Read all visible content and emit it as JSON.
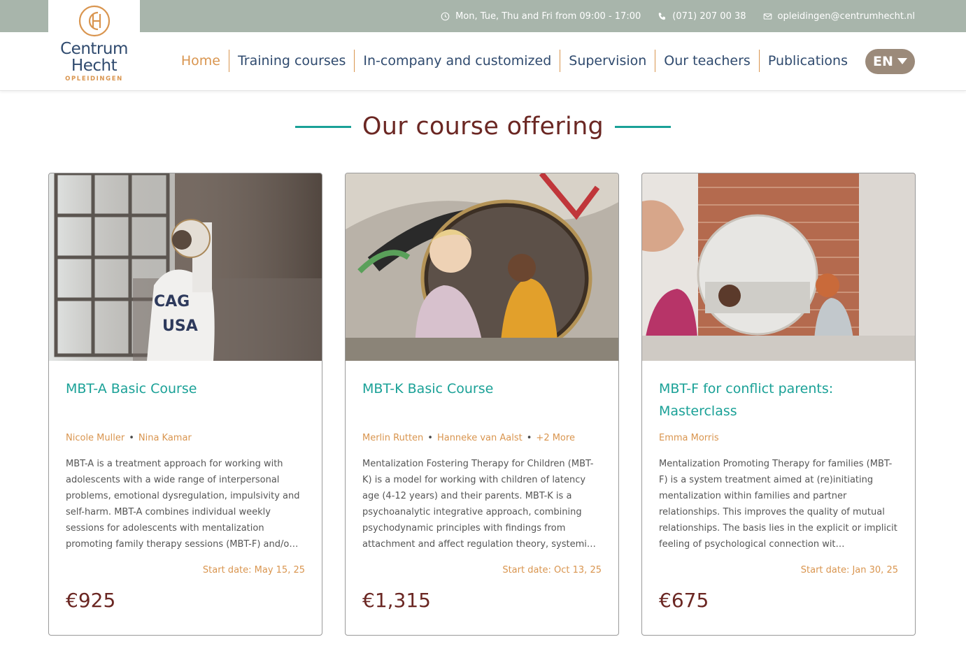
{
  "topbar": {
    "hours": "Mon, Tue, Thu and Fri from 09:00 - 17:00",
    "phone": "(071) 207 00 38",
    "email": "opleidingen@centrumhecht.nl"
  },
  "logo": {
    "line1": "Centrum",
    "line2": "Hecht",
    "sub": "OPLEIDINGEN"
  },
  "nav": {
    "items": [
      {
        "label": "Home"
      },
      {
        "label": "Training courses"
      },
      {
        "label": "In-company and customized"
      },
      {
        "label": "Supervision"
      },
      {
        "label": "Our teachers"
      },
      {
        "label": "Publications"
      }
    ],
    "lang": "EN"
  },
  "section": {
    "title": "Our course offering"
  },
  "courses": [
    {
      "title": "MBT-A Basic Course",
      "teachers": [
        "Nicole Muller",
        "Nina Kamar"
      ],
      "more": "",
      "description": "MBT-A is a treatment approach for working with adolescents with a wide range of interpersonal problems, emotional dysregulation, impulsivity and self-harm. MBT-A combines individual weekly sessions for adolescents with mentalization promoting family therapy sessions (MBT-F) and/o…",
      "start": "Start date: May 15, 25",
      "price": "€925"
    },
    {
      "title": "MBT-K Basic Course",
      "teachers": [
        "Merlin Rutten",
        "Hanneke van Aalst"
      ],
      "more": "+2 More",
      "description": "Mentalization Fostering Therapy for Children (MBT-K) is a model for working with children of latency age (4-12 years) and their parents. MBT-K is a psychoanalytic integrative approach, combining psychodynamic principles with findings from attachment and affect regulation theory, systemi…",
      "start": "Start date: Oct 13, 25",
      "price": "€1,315"
    },
    {
      "title": "MBT-F for conflict parents: Masterclass",
      "teachers": [
        "Emma Morris"
      ],
      "more": "",
      "description": "Mentalization Promoting Therapy for families (MBT-F) is a system treatment aimed at (re)initiating mentalization within families and partner relationships. This improves the quality of mutual relationships. The basis lies in the explicit or implicit feeling of psychological connection wit…",
      "start": "Start date: Jan 30, 25",
      "price": "€675"
    }
  ],
  "colors": {
    "topbar": "#a8b5ab",
    "accent_orange": "#d9954f",
    "navy": "#2f4a6e",
    "teal": "#1aa197",
    "maroon": "#6b2723",
    "lang_bg": "#9b8a7a"
  }
}
